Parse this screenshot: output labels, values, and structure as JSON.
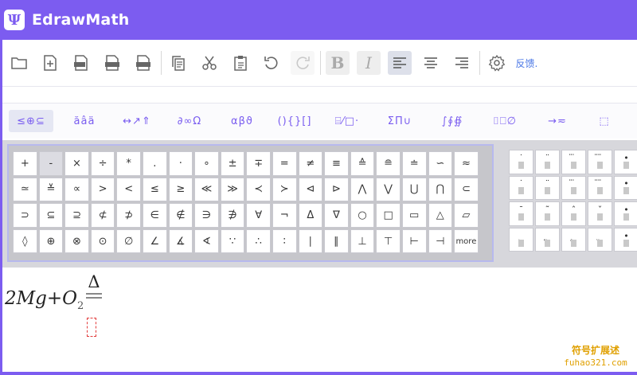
{
  "app": {
    "logo_glyph": "Ψ",
    "title": "EdrawMath",
    "accent": "#7c5cf0"
  },
  "toolbar": {
    "buttons": [
      {
        "name": "open-file-button",
        "icon": "folder-icon"
      },
      {
        "name": "new-file-button",
        "icon": "new-file-icon"
      },
      {
        "name": "export-pic-button",
        "icon": "pic-icon"
      },
      {
        "name": "export-html-button",
        "icon": "html-icon"
      },
      {
        "name": "export-tex-button",
        "icon": "tex-icon"
      },
      {
        "name": "copy-button",
        "icon": "copy-icon"
      },
      {
        "name": "cut-button",
        "icon": "scissors-icon"
      },
      {
        "name": "paste-button",
        "icon": "paste-icon"
      },
      {
        "name": "undo-button",
        "icon": "undo-icon"
      },
      {
        "name": "redo-button",
        "icon": "redo-icon"
      },
      {
        "name": "bold-button",
        "label": "B"
      },
      {
        "name": "italic-button",
        "label": "I"
      },
      {
        "name": "align-left-button",
        "icon": "align-left-icon"
      },
      {
        "name": "align-center-button",
        "icon": "align-center-icon"
      },
      {
        "name": "align-right-button",
        "icon": "align-right-icon"
      },
      {
        "name": "settings-button",
        "icon": "gear-icon"
      }
    ],
    "feedback_label": "反馈.",
    "bold_label": "B",
    "italic_label": "I"
  },
  "categories": [
    {
      "label": "≤⊕⊆",
      "active": true
    },
    {
      "label": "ăâä"
    },
    {
      "label": "↔↗⇑"
    },
    {
      "label": "∂∞Ω"
    },
    {
      "label": "αβϑ"
    },
    {
      "label": "(){}[]"
    },
    {
      "label": "⌸⁄□·"
    },
    {
      "label": "ΣΠ∪"
    },
    {
      "label": "∫∮∯"
    },
    {
      "label": "⌷⎕∅"
    },
    {
      "label": "→≂"
    },
    {
      "label": "⬚"
    }
  ],
  "symbols": [
    "+",
    "-",
    "×",
    "÷",
    "*",
    ".",
    "·",
    "∘",
    "±",
    "∓",
    "=",
    "≠",
    "≡",
    "≙",
    "≘",
    "≐",
    "∽",
    "≈",
    "≃",
    "≚",
    "∝",
    ">",
    "<",
    "≤",
    "≥",
    "≪",
    "≫",
    "≺",
    "≻",
    "⊲",
    "⊳",
    "⋀",
    "⋁",
    "⋃",
    "⋂",
    "⊂",
    "⊃",
    "⊆",
    "⊇",
    "⊄",
    "⊅",
    "∈",
    "∉",
    "∋",
    "∌",
    "∀",
    "¬",
    "Δ",
    "∇",
    "○",
    "□",
    "▭",
    "△",
    "▱",
    "◊",
    "⊕",
    "⊗",
    "⊙",
    "∅",
    "∠",
    "∡",
    "∢",
    "∵",
    "∴",
    "∶",
    "∣",
    "∥",
    "⊥",
    "⊤",
    "⊢",
    "⊣",
    "more"
  ],
  "accent_symbols": [
    "˙",
    "¨",
    "⃛",
    "⃜",
    "•",
    "˙",
    "¨",
    "⃛",
    "⃜",
    "•",
    "¯",
    "˜",
    "ˆ",
    "ˇ",
    "•",
    "̣",
    "̰",
    "̭",
    "̬",
    "•"
  ],
  "editor": {
    "formula": "2Mg+O",
    "subscript": "2",
    "over": "Δ",
    "placeholder": ""
  },
  "watermark": {
    "line1": "符号扩展述",
    "line2": "fuhao321.com"
  }
}
